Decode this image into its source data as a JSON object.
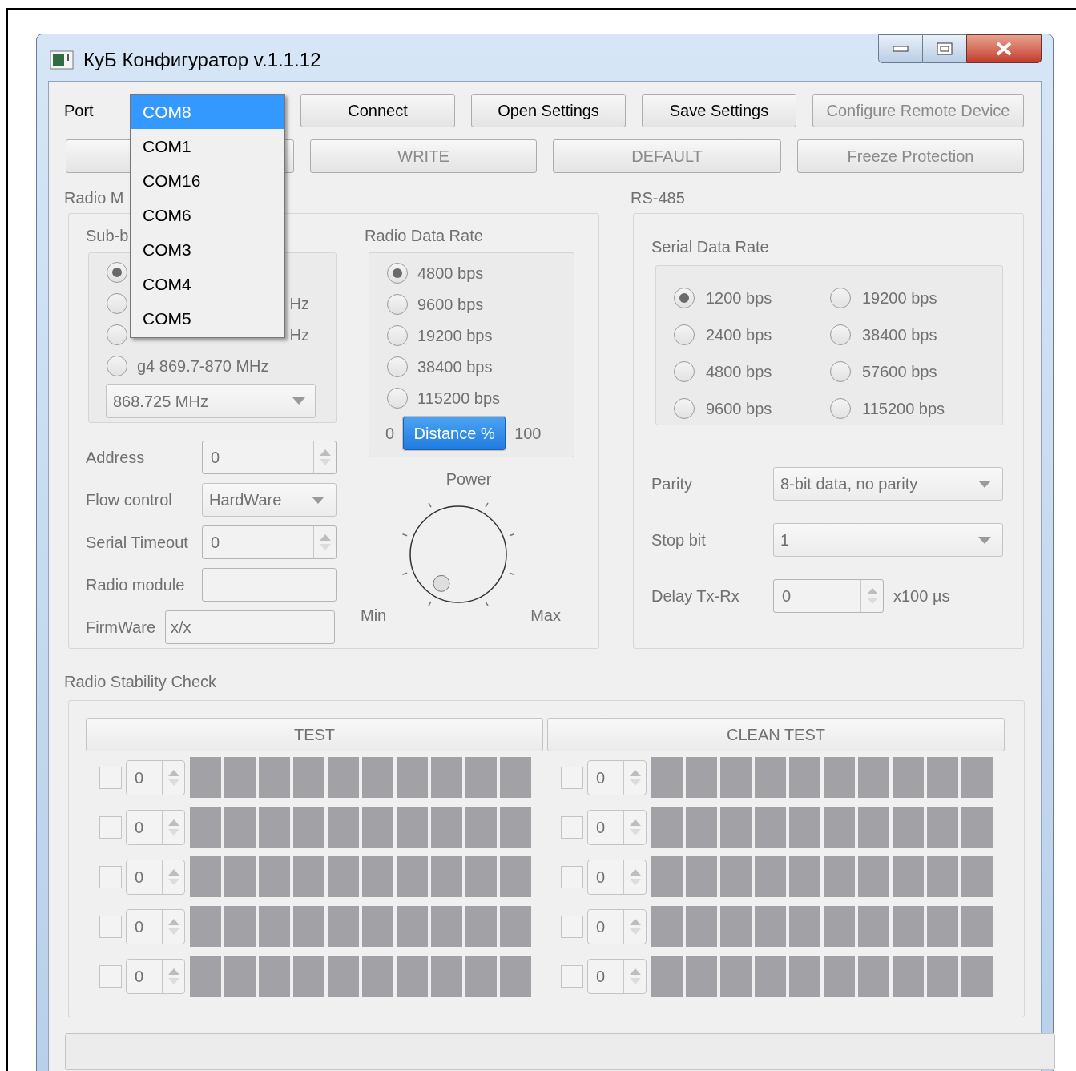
{
  "window": {
    "title": "КуБ Конфигуратор v.1.1.12"
  },
  "port": {
    "label": "Port",
    "dropdown": [
      {
        "label": "COM8",
        "selected": true
      },
      {
        "label": "COM1",
        "selected": false
      },
      {
        "label": "COM16",
        "selected": false
      },
      {
        "label": "COM6",
        "selected": false
      },
      {
        "label": "COM3",
        "selected": false
      },
      {
        "label": "COM4",
        "selected": false
      },
      {
        "label": "COM5",
        "selected": false
      }
    ]
  },
  "top_buttons": [
    {
      "label": "Connect",
      "disabled": false
    },
    {
      "label": "Open Settings",
      "disabled": false
    },
    {
      "label": "Save Settings",
      "disabled": false
    },
    {
      "label": "Configure Remote Device",
      "disabled": true
    }
  ],
  "action_buttons": [
    {
      "label": "WRITE",
      "disabled": true
    },
    {
      "label": "DEFAULT",
      "disabled": true
    },
    {
      "label": "Freeze Protection",
      "disabled": true
    }
  ],
  "radio_module": {
    "title": "Radio M",
    "sub_band": {
      "title": "Sub-b",
      "options": [
        {
          "selected": true
        },
        {
          "visible_tail": "Hz",
          "selected": false
        },
        {
          "visible_tail": "Hz",
          "selected": false
        },
        {
          "label": "g4 869.7-870 MHz",
          "selected": false
        }
      ],
      "frequency": "868.725 MHz"
    },
    "radio_data_rate": {
      "title": "Radio Data Rate",
      "options": [
        {
          "label": "4800 bps",
          "selected": true
        },
        {
          "label": "9600 bps",
          "selected": false
        },
        {
          "label": "19200 bps",
          "selected": false
        },
        {
          "label": "38400 bps",
          "selected": false
        },
        {
          "label": "115200 bps",
          "selected": false
        }
      ],
      "distance": {
        "min": "0",
        "label": "Distance %",
        "max": "100",
        "level": 1
      }
    },
    "fields": [
      {
        "kind": "spin",
        "label": "Address",
        "value": "0"
      },
      {
        "kind": "combo",
        "label": "Flow control",
        "value": "HardWare"
      },
      {
        "kind": "spin",
        "label": "Serial Timeout",
        "value": "0"
      },
      {
        "kind": "text",
        "label": "Radio module"
      },
      {
        "kind": "wide",
        "label": "FirmWare",
        "value": "x/x"
      }
    ],
    "power": {
      "title": "Power",
      "min": "Min",
      "max": "Max"
    }
  },
  "rs485": {
    "title": "RS-485",
    "serial_data_rate": {
      "title": "Serial Data Rate",
      "options": [
        {
          "label": "1200 bps",
          "selected": true
        },
        {
          "label": "2400 bps",
          "selected": false
        },
        {
          "label": "4800 bps",
          "selected": false
        },
        {
          "label": "9600 bps",
          "selected": false
        },
        {
          "label": "19200 bps",
          "selected": false
        },
        {
          "label": "38400 bps",
          "selected": false
        },
        {
          "label": "57600 bps",
          "selected": false
        },
        {
          "label": "115200 bps",
          "selected": false
        }
      ]
    },
    "fields": [
      {
        "kind": "combo",
        "label": "Parity",
        "value": "8-bit data, no parity"
      },
      {
        "kind": "combo",
        "label": "Stop bit",
        "value": "1"
      },
      {
        "kind": "spin",
        "label": "Delay Tx-Rx",
        "value": "0",
        "unit": "x100 µs"
      }
    ]
  },
  "stability": {
    "title": "Radio Stability Check",
    "panels": [
      {
        "button": "TEST",
        "rows": [
          {
            "checked": false,
            "value": "0"
          },
          {
            "checked": false,
            "value": "0"
          },
          {
            "checked": false,
            "value": "0"
          },
          {
            "checked": false,
            "value": "0"
          },
          {
            "checked": false,
            "value": "0"
          }
        ]
      },
      {
        "button": "CLEAN TEST",
        "rows": [
          {
            "checked": false,
            "value": "0"
          },
          {
            "checked": false,
            "value": "0"
          },
          {
            "checked": false,
            "value": "0"
          },
          {
            "checked": false,
            "value": "0"
          },
          {
            "checked": false,
            "value": "0"
          }
        ]
      }
    ]
  }
}
